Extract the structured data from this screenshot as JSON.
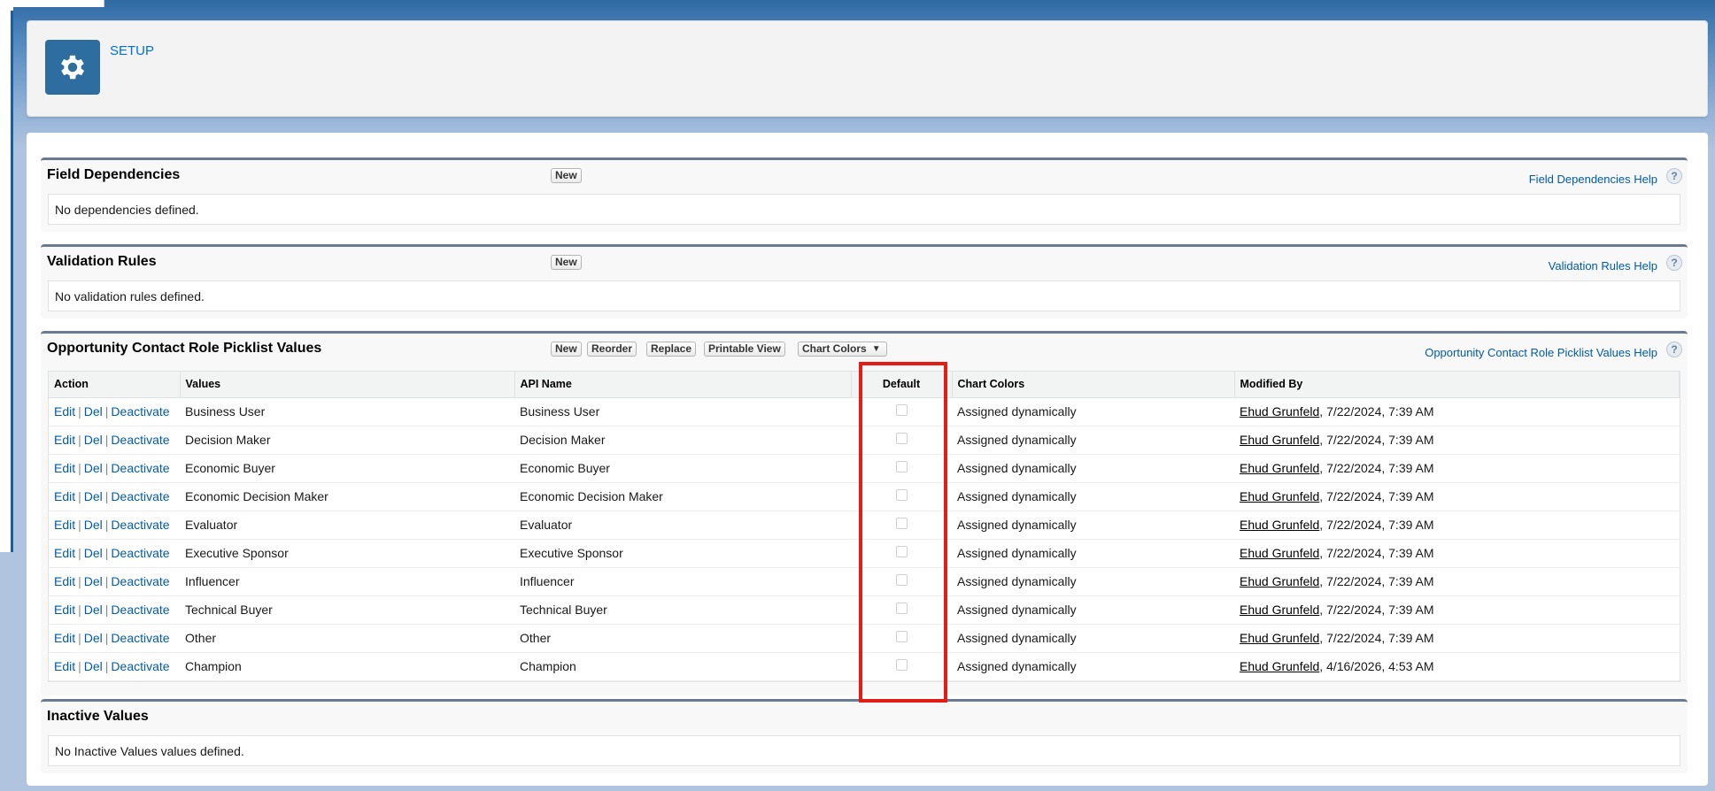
{
  "header": {
    "title": "SETUP",
    "icon": "gear-icon"
  },
  "field_dependencies": {
    "title": "Field Dependencies",
    "new_label": "New",
    "help_label": "Field Dependencies Help",
    "empty_text": "No dependencies defined."
  },
  "validation_rules": {
    "title": "Validation Rules",
    "new_label": "New",
    "help_label": "Validation Rules Help",
    "empty_text": "No validation rules defined."
  },
  "picklist": {
    "title": "Opportunity Contact Role Picklist Values",
    "buttons": {
      "new": "New",
      "reorder": "Reorder",
      "replace": "Replace",
      "printable": "Printable View",
      "chart_colors": "Chart Colors"
    },
    "help_label": "Opportunity Contact Role Picklist Values Help",
    "columns": {
      "action": "Action",
      "values": "Values",
      "api_name": "API Name",
      "default": "Default",
      "chart_colors": "Chart Colors",
      "modified_by": "Modified By"
    },
    "action_labels": {
      "edit": "Edit",
      "del": "Del",
      "deactivate": "Deactivate",
      "sep": "|"
    },
    "rows": [
      {
        "value": "Business User",
        "api": "Business User",
        "color": "Assigned dynamically",
        "user": "Ehud Grunfeld",
        "date": ", 7/22/2024, 7:39 AM"
      },
      {
        "value": "Decision Maker",
        "api": "Decision Maker",
        "color": "Assigned dynamically",
        "user": "Ehud Grunfeld",
        "date": ", 7/22/2024, 7:39 AM"
      },
      {
        "value": "Economic Buyer",
        "api": "Economic Buyer",
        "color": "Assigned dynamically",
        "user": "Ehud Grunfeld",
        "date": ", 7/22/2024, 7:39 AM"
      },
      {
        "value": "Economic Decision Maker",
        "api": "Economic Decision Maker",
        "color": "Assigned dynamically",
        "user": "Ehud Grunfeld",
        "date": ", 7/22/2024, 7:39 AM"
      },
      {
        "value": "Evaluator",
        "api": "Evaluator",
        "color": "Assigned dynamically",
        "user": "Ehud Grunfeld",
        "date": ", 7/22/2024, 7:39 AM"
      },
      {
        "value": "Executive Sponsor",
        "api": "Executive Sponsor",
        "color": "Assigned dynamically",
        "user": "Ehud Grunfeld",
        "date": ", 7/22/2024, 7:39 AM"
      },
      {
        "value": "Influencer",
        "api": "Influencer",
        "color": "Assigned dynamically",
        "user": "Ehud Grunfeld",
        "date": ", 7/22/2024, 7:39 AM"
      },
      {
        "value": "Technical Buyer",
        "api": "Technical Buyer",
        "color": "Assigned dynamically",
        "user": "Ehud Grunfeld",
        "date": ", 7/22/2024, 7:39 AM"
      },
      {
        "value": "Other",
        "api": "Other",
        "color": "Assigned dynamically",
        "user": "Ehud Grunfeld",
        "date": ", 7/22/2024, 7:39 AM"
      },
      {
        "value": "Champion",
        "api": "Champion",
        "color": "Assigned dynamically",
        "user": "Ehud Grunfeld",
        "date": ", 4/16/2026, 4:53 AM"
      }
    ]
  },
  "inactive": {
    "title": "Inactive Values",
    "empty_text": "No Inactive Values values defined."
  },
  "colors": {
    "accent": "#015ba7",
    "highlight": "#e21d17",
    "header_icon_bg": "#2e6da0"
  }
}
